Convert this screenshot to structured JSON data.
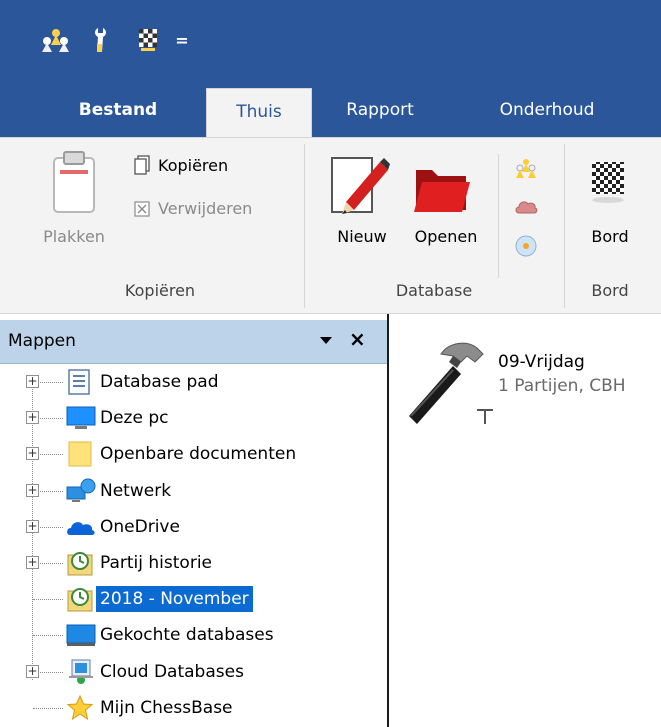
{
  "quick_access": {
    "icons": [
      "chess-pieces-icon",
      "wrench-icon",
      "board-icon",
      "customize-icon"
    ],
    "customize_glyph": "="
  },
  "tabs": [
    {
      "label": "Bestand"
    },
    {
      "label": "Thuis"
    },
    {
      "label": "Rapport"
    },
    {
      "label": "Onderhoud"
    }
  ],
  "ribbon": {
    "copy_group": {
      "paste_label": "Plakken",
      "copy_label": "Kopiëren",
      "delete_label": "Verwijderen",
      "group_label": "Kopiëren"
    },
    "database_group": {
      "new_label": "Nieuw",
      "open_label": "Openen",
      "group_label": "Database"
    },
    "board_group": {
      "board_label": "Bord",
      "group_label": "Bord"
    }
  },
  "folders_pane": {
    "title": "Mappen",
    "close_glyph": "×",
    "items": [
      {
        "label": "Database pad",
        "icon": "database-path-icon",
        "expandable": true,
        "selected": false
      },
      {
        "label": "Deze pc",
        "icon": "computer-icon",
        "expandable": true,
        "selected": false
      },
      {
        "label": "Openbare documenten",
        "icon": "folder-icon",
        "expandable": true,
        "selected": false
      },
      {
        "label": "Netwerk",
        "icon": "network-icon",
        "expandable": true,
        "selected": false
      },
      {
        "label": "OneDrive",
        "icon": "onedrive-icon",
        "expandable": true,
        "selected": false
      },
      {
        "label": "Partij historie",
        "icon": "history-icon",
        "expandable": true,
        "selected": false
      },
      {
        "label": "2018 - November",
        "icon": "history-icon",
        "expandable": false,
        "selected": true
      },
      {
        "label": "Gekochte databases",
        "icon": "purchased-db-icon",
        "expandable": false,
        "selected": false
      },
      {
        "label": "Cloud Databases",
        "icon": "cloud-db-icon",
        "expandable": true,
        "selected": false
      },
      {
        "label": "Mijn ChessBase",
        "icon": "star-icon",
        "expandable": false,
        "selected": false
      }
    ]
  },
  "content": {
    "database": {
      "title": "09-Vrijdag",
      "subtitle": "1 Partijen, CBH",
      "icon": "hammer-icon"
    }
  },
  "colors": {
    "titlebar": "#2b579a",
    "ribbon": "#f3f3f3",
    "pane_header": "#bcd3ea",
    "selection": "#0b6bd3"
  }
}
